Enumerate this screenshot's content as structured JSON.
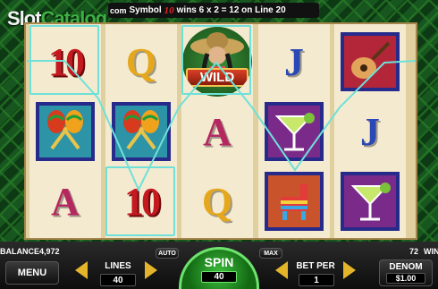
{
  "logo": {
    "part1": "Slot",
    "part2": "Catalog",
    "com": "com"
  },
  "win_message": {
    "prefix": "Symbol",
    "symbol": "10",
    "text": "wins 6 x 2 = 12 on Line 20"
  },
  "reels": [
    [
      "10",
      "maracas",
      "A"
    ],
    [
      "Q",
      "maracas",
      "10"
    ],
    [
      "wild",
      "A",
      "Q"
    ],
    [
      "J",
      "margarita",
      "pinata"
    ],
    [
      "guitar",
      "J",
      "margarita"
    ]
  ],
  "wild_text": "WILD",
  "balance": {
    "label": "BALANCE",
    "value": "4,972"
  },
  "win_amount": {
    "value": "72",
    "label": "WIN"
  },
  "buttons": {
    "menu": "MENU",
    "lines_label": "LINES",
    "lines_value": "40",
    "auto": "AUTO",
    "max": "MAX",
    "spin": "SPIN",
    "spin_value": "40",
    "bet_per_label": "BET PER",
    "bet_per_value": "1",
    "denom_label": "DENOM",
    "denom_value": "$1.00"
  },
  "colors": {
    "accent_green": "#3cb043",
    "win_line": "#6fe1d8",
    "arrow_gold": "#e4b52a"
  }
}
